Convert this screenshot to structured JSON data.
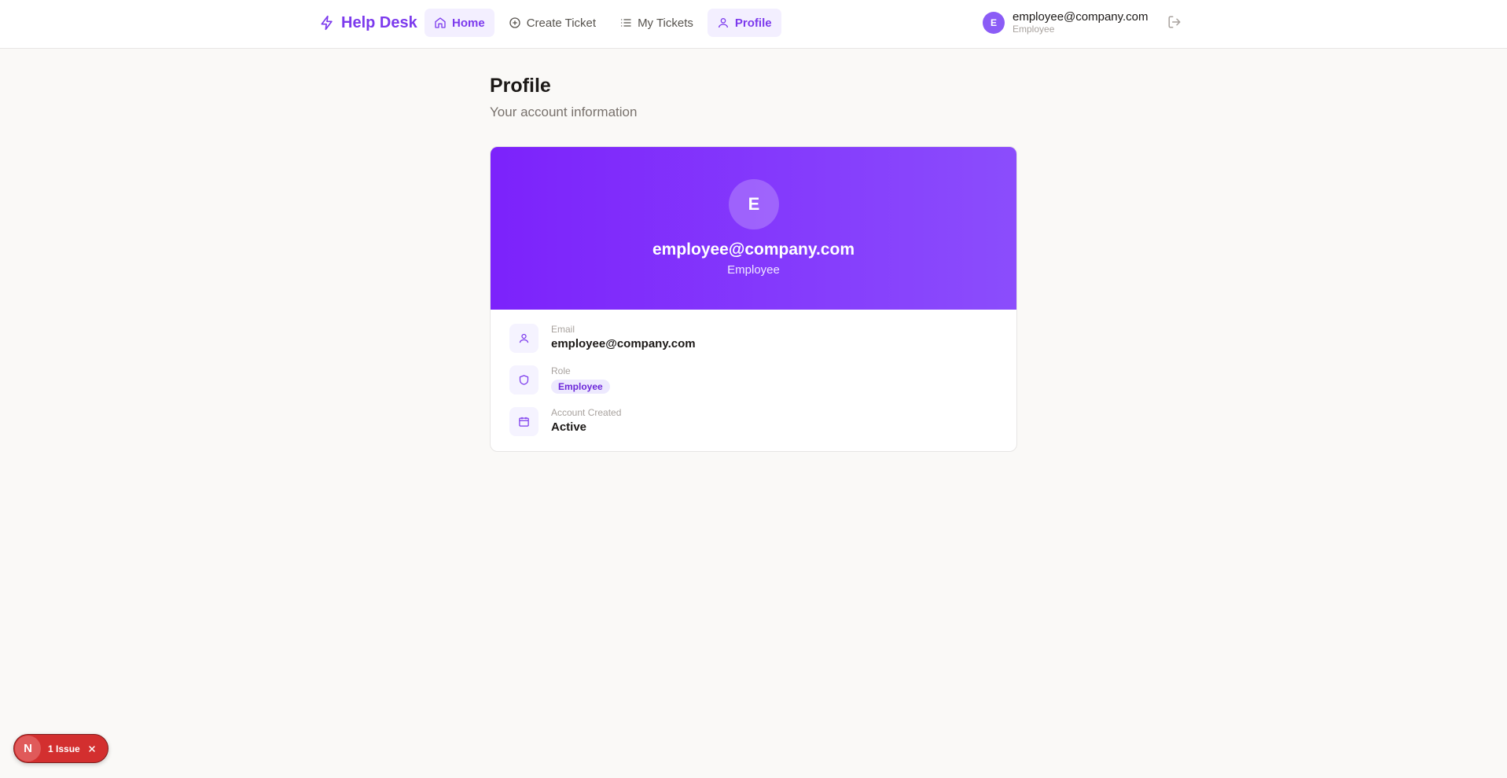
{
  "app": {
    "brand": "Help Desk"
  },
  "nav": {
    "home": "Home",
    "create_ticket": "Create Ticket",
    "my_tickets": "My Tickets",
    "profile": "Profile"
  },
  "user": {
    "initial": "E",
    "email": "employee@company.com",
    "role": "Employee"
  },
  "page": {
    "title": "Profile",
    "subtitle": "Your account information"
  },
  "profile_card": {
    "initial": "E",
    "email": "employee@company.com",
    "role": "Employee",
    "fields": {
      "email_label": "Email",
      "email_value": "employee@company.com",
      "role_label": "Role",
      "role_value": "Employee",
      "created_label": "Account Created",
      "created_value": "Active"
    }
  },
  "dev_overlay": {
    "logo": "N",
    "issues_label": "1 Issue"
  },
  "colors": {
    "accent": "#7c3aed",
    "hero_start": "#7c22fb",
    "hero_end": "#8b4dfc",
    "issue_red": "#d32f2f"
  }
}
